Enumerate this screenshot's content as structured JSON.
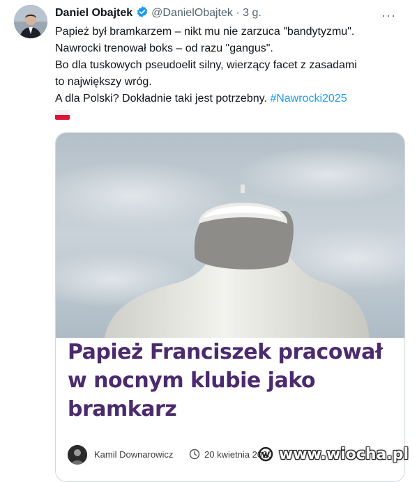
{
  "tweet": {
    "author_name": "Daniel Obajtek",
    "handle": "@DanielObajtek",
    "separator": "·",
    "time": "3 g.",
    "lines": [
      "Papież był bramkarzem – nikt mu nie zarzuca \"bandytyzmu\".",
      "Nawrocki trenował boks – od razu \"gangus\".",
      "Bo dla tuskowych pseudoelit silny, wierzący facet z zasadami",
      "to największy wróg."
    ],
    "last_line_text": "A dla Polski? Dokładnie taki jest potrzebny. ",
    "hashtag": "#Nawrocki2025",
    "flag_emoji": "poland-flag-icon"
  },
  "card": {
    "title_lines": [
      "Papież Franciszek pracował",
      "w nocnym klubie jako",
      "bramkarz"
    ],
    "author": "Kamil Downarowicz",
    "date": "20 kwietnia 2020"
  },
  "watermark": "www.wiocha.pl",
  "colors": {
    "hashtag": "#1d9bf0",
    "verified": "#1d9bf0",
    "card_title": "#4b2a6e",
    "secondary_text": "#536471"
  }
}
